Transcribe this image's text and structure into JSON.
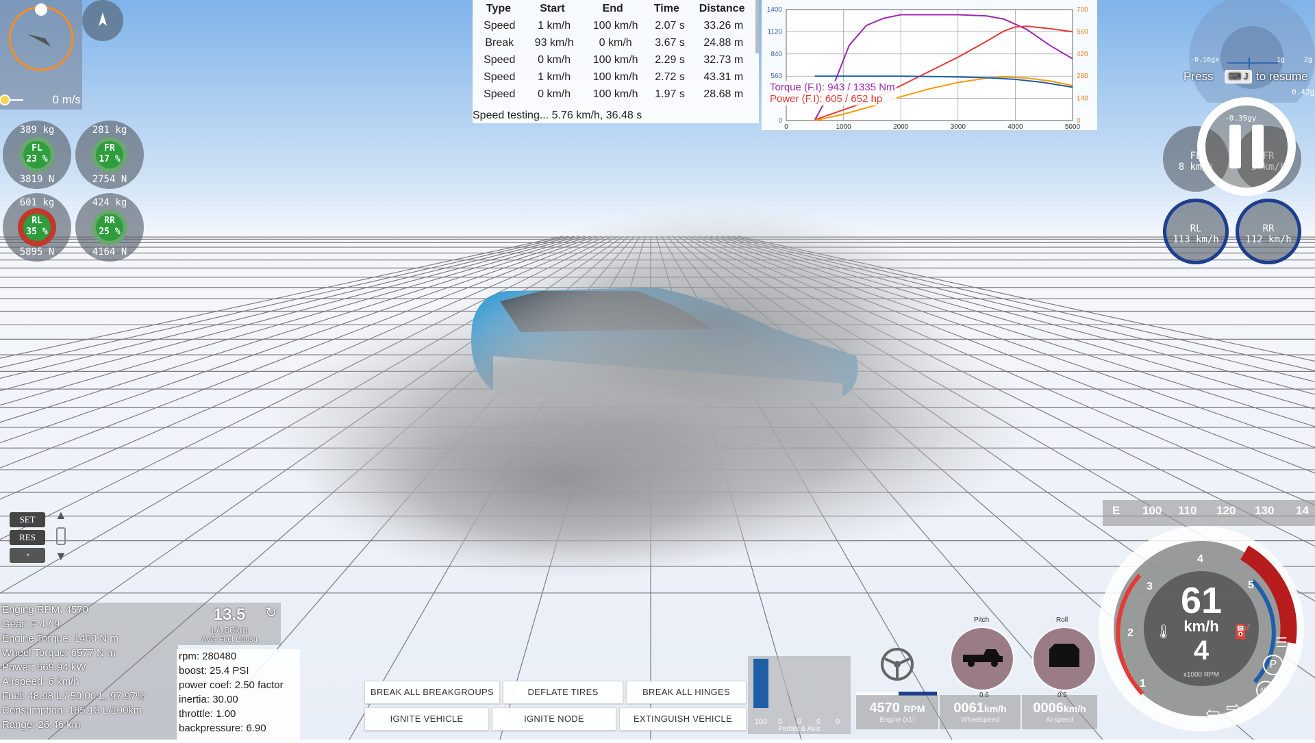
{
  "speed_test": {
    "headers": [
      "Type",
      "Start",
      "End",
      "Time",
      "Distance"
    ],
    "rows": [
      [
        "Speed",
        "1 km/h",
        "100 km/h",
        "2.07 s",
        "33.26 m"
      ],
      [
        "Break",
        "93 km/h",
        "0 km/h",
        "3.67 s",
        "24.88 m"
      ],
      [
        "Speed",
        "0 km/h",
        "100 km/h",
        "2.29 s",
        "32.73 m"
      ],
      [
        "Speed",
        "1 km/h",
        "100 km/h",
        "2.72 s",
        "43.31 m"
      ],
      [
        "Speed",
        "0 km/h",
        "100 km/h",
        "1.97 s",
        "28.68 m"
      ]
    ],
    "status": "Speed testing... 5.76 km/h, 36.48 s"
  },
  "chart_data": {
    "type": "line",
    "title": "",
    "xlabel": "",
    "ylabel": "",
    "xlim": [
      0,
      5000
    ],
    "ylim_left": [
      0,
      1400
    ],
    "ylim_right": [
      0,
      700
    ],
    "x_ticks": [
      0,
      1000,
      2000,
      3000,
      4000,
      5000
    ],
    "y_left_ticks": [
      0,
      280,
      560,
      840,
      1120,
      1400
    ],
    "y_right_ticks": [
      0,
      140,
      280,
      420,
      560,
      700
    ],
    "legend": [
      {
        "text": "Torque (F.I): 943 / 1335 Nm",
        "color": "#9b27b0"
      },
      {
        "text": "Power (F.I): 605 / 652 hp",
        "color": "#e53935"
      }
    ],
    "series": [
      {
        "color": "#9b27b0",
        "axis": "left",
        "x": [
          500,
          800,
          1100,
          1400,
          1700,
          2000,
          3000,
          3500,
          3800,
          4200,
          4600,
          5000
        ],
        "y": [
          10,
          400,
          950,
          1200,
          1290,
          1335,
          1335,
          1320,
          1280,
          1150,
          950,
          780
        ]
      },
      {
        "color": "#e53935",
        "axis": "right",
        "x": [
          500,
          1500,
          2000,
          2500,
          3000,
          3500,
          3800,
          4000,
          4200,
          4600,
          5000
        ],
        "y": [
          5,
          130,
          220,
          310,
          400,
          500,
          565,
          590,
          595,
          580,
          560
        ]
      },
      {
        "color": "#ff9800",
        "axis": "right",
        "x": [
          500,
          1000,
          1500,
          2000,
          2500,
          3000,
          3500,
          3800,
          4200,
          4600,
          5000
        ],
        "y": [
          0,
          40,
          90,
          150,
          200,
          240,
          268,
          275,
          268,
          250,
          220
        ]
      },
      {
        "color": "#1e5fa8",
        "axis": "left",
        "x": [
          500,
          1000,
          1500,
          2000,
          2500,
          3000,
          3500,
          4000,
          4500,
          5000
        ],
        "y": [
          560,
          560,
          560,
          560,
          555,
          550,
          540,
          520,
          480,
          420
        ]
      }
    ]
  },
  "hud": {
    "velocity": "0 m/s",
    "tires": [
      {
        "id": "fl",
        "mass": "389  kg",
        "label": "FL",
        "pct": "23 %",
        "force": "3819  N"
      },
      {
        "id": "fr",
        "mass": "281  kg",
        "label": "FR",
        "pct": "17 %",
        "force": "2754  N"
      },
      {
        "id": "rl",
        "mass": "601  kg",
        "label": "RL",
        "pct": "35 %",
        "force": "5895  N"
      },
      {
        "id": "rr",
        "mass": "424  kg",
        "label": "RR",
        "pct": "25 %",
        "force": "4164  N"
      }
    ],
    "wheels_right": [
      {
        "label": "FL",
        "speed": "8  km/h"
      },
      {
        "label": "FR",
        "speed": "5  km/h"
      },
      {
        "label": "RL",
        "speed": "113  km/h"
      },
      {
        "label": "RR",
        "speed": "112  km/h"
      }
    ],
    "g_meter": {
      "left": "-0.16gx",
      "mid": "1g",
      "right": "2g",
      "bottom": "0.42g",
      "inner": "-0.39gy"
    },
    "pause_hint": {
      "press": "Press",
      "key": "J",
      "rest": "to resume"
    },
    "cruise": {
      "set": "SET",
      "res": "RES"
    }
  },
  "vehicle_info": {
    "lines": [
      "Enging RPM: 4570",
      "Gear: F 4 / 9",
      "Engine Torque: 1400 N m",
      "Wheel Torque: 6577 N m",
      "Power: 669.94 kW",
      "Airspeed: 6 km/h",
      "Fuel: 48.98 L / 50.00 L, 97.97%",
      "Consumption: 185.13 L/100km",
      "Range: 26.46 km"
    ],
    "fuel_value": "13.5",
    "fuel_unit": "L/100km",
    "fuel_label": "AVG Fuel Consu",
    "engine_lines": [
      "rpm: 280480",
      "boost: 25.4 PSI",
      "power coef: 2.50 factor",
      "inertia: 30.00",
      "throttle: 1.00",
      "backpressure: 6.90"
    ]
  },
  "buttons": {
    "break_breakgroups": "BREAK ALL BREAKGROUPS",
    "deflate_tires": "DEFLATE TIRES",
    "break_hinges": "BREAK ALL HINGES",
    "ignite_vehicle": "IGNITE VEHICLE",
    "ignite_node": "IGNITE NODE",
    "extinguish_vehicle": "EXTINGUISH VEHICLE"
  },
  "pedals": {
    "values": [
      "100",
      "0",
      "0",
      "0",
      "0"
    ],
    "label": "Pedals & Axis",
    "throttle": 1.0
  },
  "readouts": {
    "rpm_value": "4570",
    "rpm_unit": "RPM",
    "rpm_label": "Engine (x1)",
    "wheel_value": "0061",
    "wheel_unit": "km/h",
    "wheel_label": "Wheelspeed",
    "air_value": "0006",
    "air_unit": "km/h",
    "air_label": "Airspeed"
  },
  "attitude": {
    "pitch_label": "Pitch",
    "roll_label": "Roll",
    "pitch_value": "0.6",
    "roll_value": "0.5"
  },
  "speedo": {
    "speed": "61",
    "unit": "km/h",
    "gear": "4",
    "rpm_label": "x1000 RPM",
    "ticks": [
      "1",
      "2",
      "3",
      "4",
      "5"
    ],
    "strip": [
      "E",
      "100",
      "110",
      "120",
      "130",
      "14"
    ]
  },
  "colors": {
    "accent": "#1e5fa8",
    "redline": "#c62828",
    "tire_ok": "#2e9e3d",
    "tire_warn": "#c0392b"
  }
}
